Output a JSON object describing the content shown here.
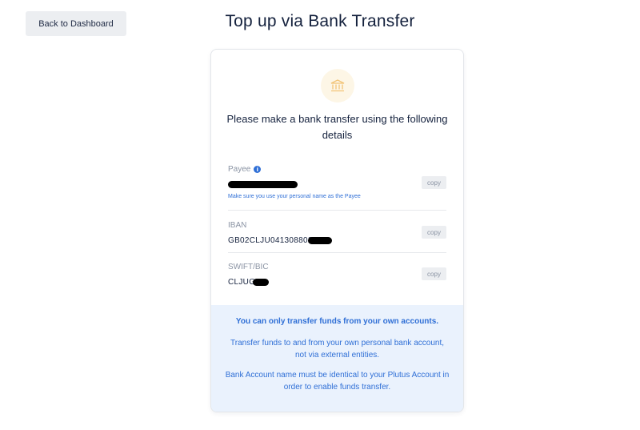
{
  "header": {
    "back_label": "Back to Dashboard",
    "title": "Top up via Bank Transfer"
  },
  "card": {
    "icon": "bank-icon",
    "heading": "Please make a bank transfer using the following details",
    "fields": {
      "payee": {
        "label": "Payee",
        "value": "",
        "hint": "Make sure you use your personal name as the Payee",
        "copy_label": "copy"
      },
      "iban": {
        "label": "IBAN",
        "value": "GB02CLJU041308802",
        "copy_label": "copy"
      },
      "swift": {
        "label": "SWIFT/BIC",
        "value": "CLJUGB",
        "copy_label": "copy"
      }
    },
    "notice": {
      "strong": "You can only transfer funds from your own accounts.",
      "p1": "Transfer funds to and from your own personal bank account, not via external entities.",
      "p2": "Bank Account name must be identical to your Plutus Account in order to enable funds transfer."
    }
  },
  "colors": {
    "accent": "#2f6fd6",
    "notice_bg": "#eaf2fd",
    "icon_bg": "#fdf6e6",
    "icon_color": "#f2c477"
  }
}
